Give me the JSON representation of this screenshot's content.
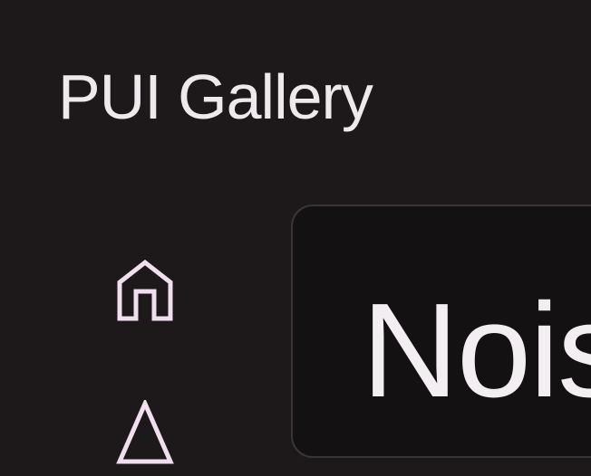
{
  "app": {
    "title": "PUI Gallery"
  },
  "sidebar": {
    "items": [
      {
        "icon": "home-icon"
      },
      {
        "icon": "triangle-icon"
      }
    ]
  },
  "main": {
    "title": "Nois"
  },
  "colors": {
    "background": "#1d191b",
    "text": "#efe9ee",
    "icon_accent": "#f1deee",
    "card_background": "#141113",
    "card_border": "#3a3438"
  }
}
